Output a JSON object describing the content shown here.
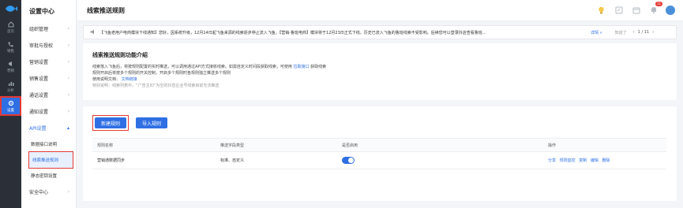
{
  "rail": {
    "items": [
      {
        "label": "首页",
        "icon": "home-icon"
      },
      {
        "label": "销售",
        "icon": "phone-icon"
      },
      {
        "label": "营销",
        "icon": "megaphone-icon"
      },
      {
        "label": "分析",
        "icon": "chart-icon"
      },
      {
        "label": "设置",
        "icon": "gear-icon"
      }
    ]
  },
  "sidebar": {
    "title": "设置中心",
    "items": [
      {
        "label": "组织管理"
      },
      {
        "label": "审批与授权"
      },
      {
        "label": "营销设置"
      },
      {
        "label": "销售设置"
      },
      {
        "label": "通话设置"
      },
      {
        "label": "通知设置"
      },
      {
        "label": "API设置"
      }
    ],
    "sub_items": [
      {
        "label": "数据接口说明"
      },
      {
        "label": "线索推送规则"
      },
      {
        "label": "静态密钥设置"
      }
    ],
    "last_item": {
      "label": "安全中心"
    }
  },
  "header": {
    "title": "线索推送规则",
    "notification_count": "11"
  },
  "notice": {
    "text": "【飞鱼老用户电商模块下线通知】您好，因系统升级，12月14日起飞鱼来源的线索逐步停止流入飞鱼，【营销-鲁班电商】模块将于12月23日正式下线，历史已流入飞鱼的鲁班线索不受影响。后续您可以登录抖店查看鲁班...",
    "detail": "详情 »",
    "mark_read": "知道了",
    "page": "1 / 11"
  },
  "intro": {
    "title": "线索推送规则功能介绍",
    "line1": "线索落入飞鱼后，将按规则配置的实时推送，可以调用通过API方式接收线索。如需自定义时间段获取线索，可使用",
    "line1_link": "拉取接口",
    "line1_tail": "获取线索",
    "line2": "规则开启后将按多个规则的开关控制，开启多个规则时各规则独立推送多个规则",
    "line3": "使用说明文档：",
    "line3_link": "文档链接",
    "line4": "特别说明：线索列表中，“广告主ID”为空的抖音企业号线索目前无法推送"
  },
  "rules": {
    "new_button": "新建规则",
    "import_button": "导入规则",
    "columns": [
      "规则名称",
      "推送字段类型",
      "是否启用",
      "操作"
    ],
    "rows": [
      {
        "name": "营销通数据同步",
        "field_type": "标准、自定义",
        "enabled": true,
        "actions": [
          "分享",
          "规则监控",
          "复制",
          "编辑",
          "删除"
        ]
      }
    ]
  },
  "colors": {
    "accent": "#2f6fe4",
    "highlight": "#e53935",
    "rail_bg": "#2b3038"
  }
}
